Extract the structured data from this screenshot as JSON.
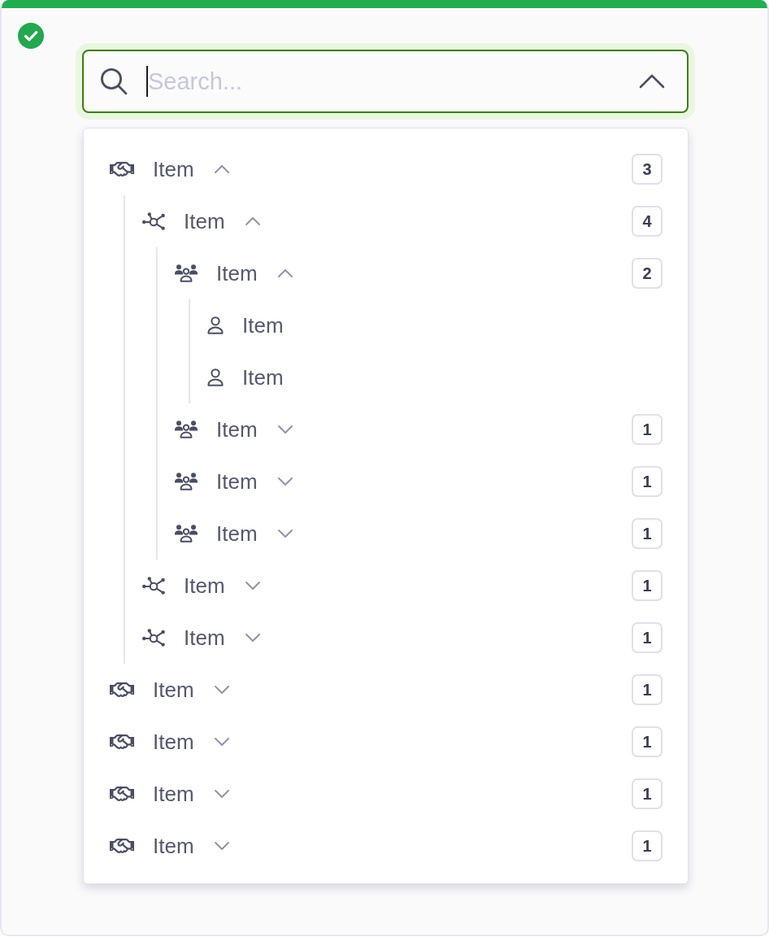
{
  "search": {
    "placeholder": "Search...",
    "valid": true,
    "focused": true,
    "open": true
  },
  "tree": [
    {
      "kind": "handshake",
      "label": "Item",
      "expanded": true,
      "count": "3",
      "children": [
        {
          "kind": "network",
          "label": "Item",
          "expanded": true,
          "count": "4",
          "children": [
            {
              "kind": "group",
              "label": "Item",
              "expanded": true,
              "count": "2",
              "children": [
                {
                  "kind": "person",
                  "label": "Item"
                },
                {
                  "kind": "person",
                  "label": "Item"
                }
              ]
            },
            {
              "kind": "group",
              "label": "Item",
              "expanded": false,
              "count": "1"
            },
            {
              "kind": "group",
              "label": "Item",
              "expanded": false,
              "count": "1"
            },
            {
              "kind": "group",
              "label": "Item",
              "expanded": false,
              "count": "1"
            }
          ]
        },
        {
          "kind": "network",
          "label": "Item",
          "expanded": false,
          "count": "1"
        },
        {
          "kind": "network",
          "label": "Item",
          "expanded": false,
          "count": "1"
        }
      ]
    },
    {
      "kind": "handshake",
      "label": "Item",
      "expanded": false,
      "count": "1"
    },
    {
      "kind": "handshake",
      "label": "Item",
      "expanded": false,
      "count": "1"
    },
    {
      "kind": "handshake",
      "label": "Item",
      "expanded": false,
      "count": "1"
    },
    {
      "kind": "handshake",
      "label": "Item",
      "expanded": false,
      "count": "1"
    }
  ]
}
